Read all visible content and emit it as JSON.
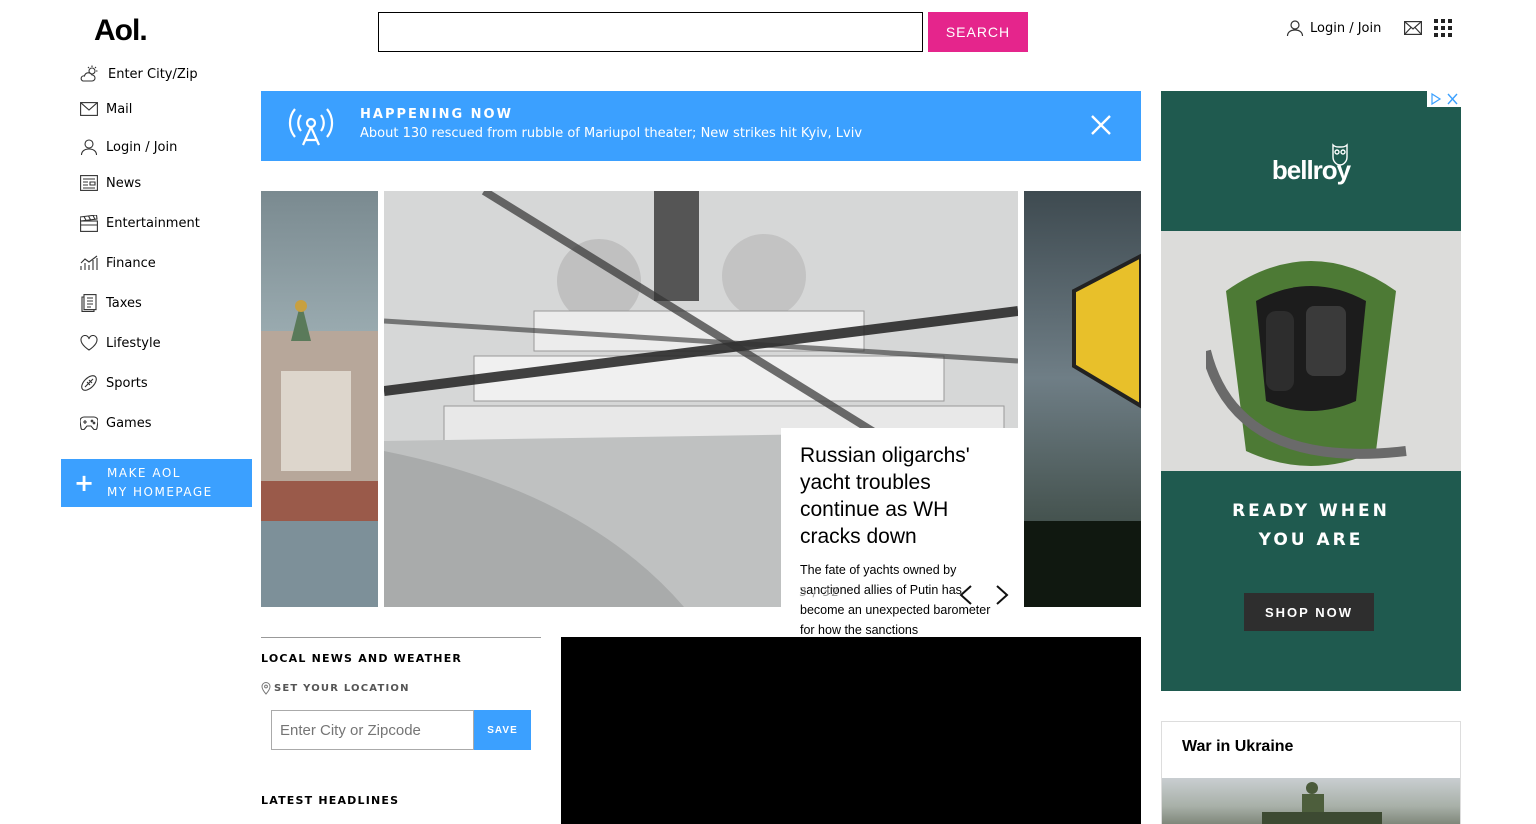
{
  "header": {
    "logo": "Aol.",
    "search_placeholder": "",
    "search_button": "SEARCH",
    "login_label": "Login / Join",
    "mail_icon": "mail-icon",
    "apps_icon": "grid-icon"
  },
  "sidebar": {
    "items": [
      {
        "label": "Enter City/Zip",
        "icon": "weather-icon"
      },
      {
        "label": "Mail",
        "icon": "mail-icon"
      },
      {
        "label": "Login / Join",
        "icon": "user-icon"
      },
      {
        "label": "News",
        "icon": "news-icon"
      },
      {
        "label": "Entertainment",
        "icon": "clapper-icon"
      },
      {
        "label": "Finance",
        "icon": "chart-icon"
      },
      {
        "label": "Taxes",
        "icon": "document-icon"
      },
      {
        "label": "Lifestyle",
        "icon": "heart-icon"
      },
      {
        "label": "Sports",
        "icon": "football-icon"
      },
      {
        "label": "Games",
        "icon": "gamepad-icon"
      }
    ],
    "homepage_line1": "MAKE AOL",
    "homepage_line2": "MY HOMEPAGE"
  },
  "happening_now": {
    "label": "HAPPENING NOW",
    "text": "About 130 rescued from rubble of Mariupol theater; New strikes hit Kyiv, Lviv"
  },
  "carousel": {
    "title": "Russian oligarchs' yacht troubles continue as WH cracks down",
    "description": "The fate of yachts owned by sanctioned allies of Putin has become an unexpected barometer for how the sanctions",
    "counter": "3 / 32"
  },
  "local_news": {
    "heading": "LOCAL NEWS AND WEATHER",
    "set_location": "SET YOUR LOCATION",
    "zip_placeholder": "Enter City or Zipcode",
    "save_button": "SAVE",
    "latest_headlines": "LATEST HEADLINES"
  },
  "ad": {
    "brand": "bellroy",
    "tagline_line1": "READY WHEN",
    "tagline_line2": "YOU ARE",
    "button": "SHOP NOW"
  },
  "war_panel": {
    "title": "War in Ukraine"
  },
  "colors": {
    "accent_blue": "#3ba0ff",
    "search_pink": "#e5258c",
    "ad_green": "#1f5a4f"
  }
}
